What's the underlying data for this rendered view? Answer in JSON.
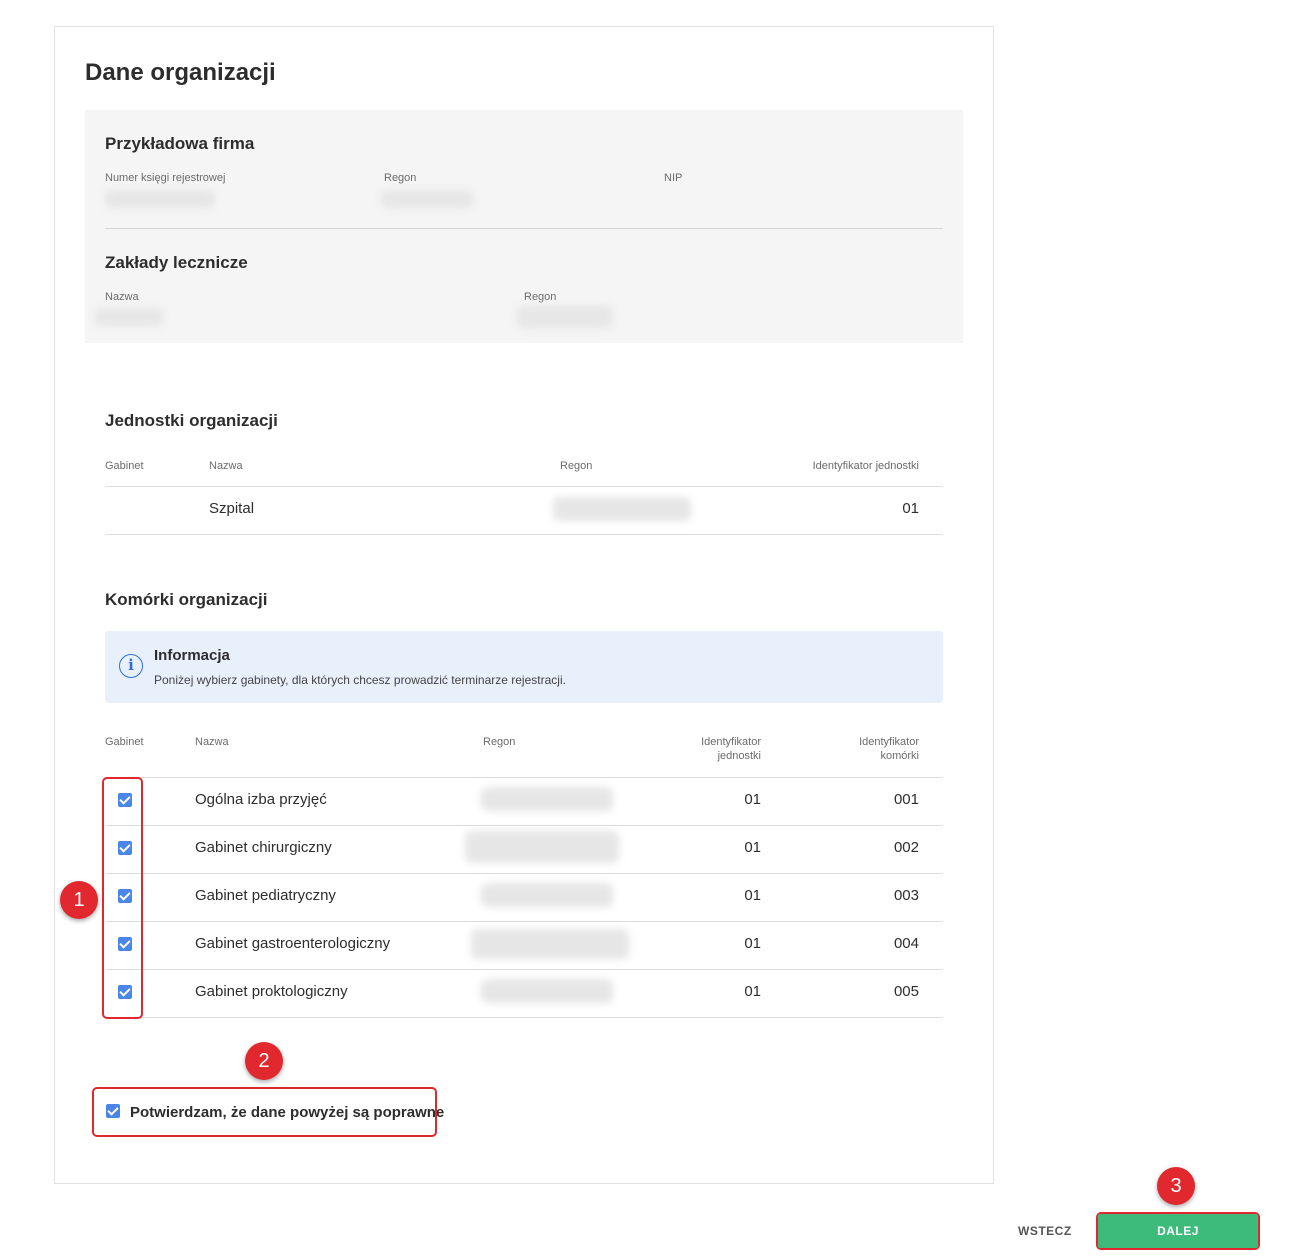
{
  "page": {
    "title": "Dane organizacji"
  },
  "company": {
    "name": "Przykładowa firma",
    "fields": {
      "krs_label": "Numer księgi rejestrowej",
      "regon_label": "Regon",
      "nip_label": "NIP"
    }
  },
  "facilities": {
    "title": "Zakłady lecznicze",
    "name_label": "Nazwa",
    "regon_label": "Regon"
  },
  "units": {
    "title": "Jednostki organizacji",
    "headers": [
      "Gabinet",
      "Nazwa",
      "Regon",
      "Identyfikator jednostki"
    ],
    "rows": [
      {
        "name": "Szpital",
        "unit_id": "01"
      }
    ]
  },
  "cells": {
    "title": "Komórki organizacji",
    "info": {
      "title": "Informacja",
      "text": "Poniżej wybierz gabinety, dla których chcesz prowadzić terminarze rejestracji.",
      "icon": "info-icon"
    },
    "headers": {
      "gabinet": "Gabinet",
      "nazwa": "Nazwa",
      "regon": "Regon",
      "unit_id_1": "Identyfikator",
      "unit_id_2": "jednostki",
      "cell_id_1": "Identyfikator",
      "cell_id_2": "komórki"
    },
    "rows": [
      {
        "checked": true,
        "name": "Ogólna izba przyjęć",
        "unit_id": "01",
        "cell_id": "001"
      },
      {
        "checked": true,
        "name": "Gabinet chirurgiczny",
        "unit_id": "01",
        "cell_id": "002"
      },
      {
        "checked": true,
        "name": "Gabinet pediatryczny",
        "unit_id": "01",
        "cell_id": "003"
      },
      {
        "checked": true,
        "name": "Gabinet gastroenterologiczny",
        "unit_id": "01",
        "cell_id": "004"
      },
      {
        "checked": true,
        "name": "Gabinet proktologiczny",
        "unit_id": "01",
        "cell_id": "005"
      }
    ]
  },
  "confirmation": {
    "checked": true,
    "label": "Potwierdzam, że dane powyżej są poprawne"
  },
  "annotations": {
    "badge1": "1",
    "badge2": "2",
    "badge3": "3",
    "color": "#e0282e"
  },
  "actions": {
    "back_label": "WSTECZ",
    "next_label": "DALEJ",
    "next_color": "#3dbb7a"
  },
  "colors": {
    "accent": "#4a86e8",
    "info_bg": "#e8f0fc"
  }
}
